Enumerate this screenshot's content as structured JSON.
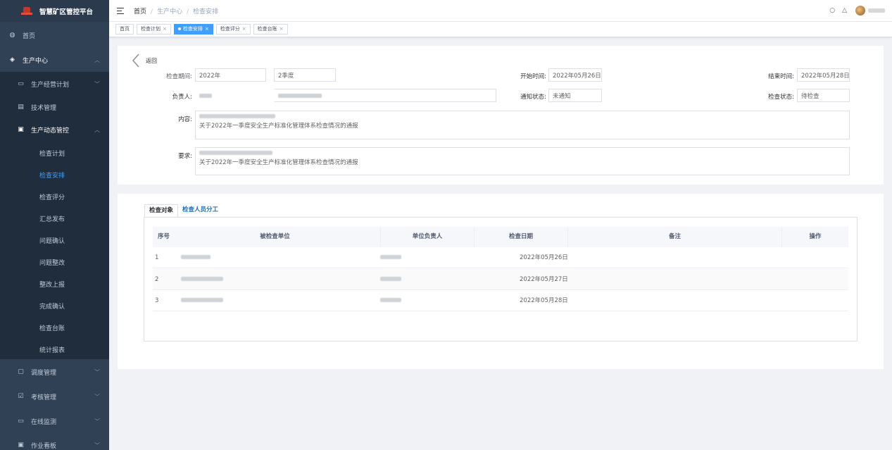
{
  "app": {
    "title": "智慧矿区管控平台"
  },
  "sidebar": {
    "home": "首页",
    "production_center": "生产中心",
    "items": [
      {
        "label": "生产经营计划",
        "icon": "book-icon"
      },
      {
        "label": "技术管理",
        "icon": "clipboard-icon"
      },
      {
        "label": "生产动态管控",
        "icon": "chart-icon"
      }
    ],
    "subitems": [
      "检查计划",
      "检查安排",
      "检查评分",
      "汇总发布",
      "问题确认",
      "问题整改",
      "整改上报",
      "完成确认",
      "检查台账",
      "统计报表"
    ],
    "active_sub": "检查安排",
    "bottom": [
      "调度管理",
      "考核管理",
      "在线监测",
      "作业看板"
    ],
    "colors": {
      "bg": "#304156",
      "active": "#409eff"
    }
  },
  "navbar": {
    "breadcrumb": [
      "首页",
      "生产中心",
      "检查安排"
    ]
  },
  "tags": [
    {
      "label": "首页",
      "closable": false,
      "active": false
    },
    {
      "label": "检查计划",
      "closable": true,
      "active": false
    },
    {
      "label": "检查安排",
      "closable": true,
      "active": true
    },
    {
      "label": "检查评分",
      "closable": true,
      "active": false
    },
    {
      "label": "检查台账",
      "closable": true,
      "active": false
    }
  ],
  "form": {
    "back_label": "返回",
    "period_label": "检查期间:",
    "year_value": "2022年",
    "quarter_value": "2季度",
    "start_label": "开始时间:",
    "start_value": "2022年05月26日",
    "end_label": "结束时间:",
    "end_value": "2022年05月28日",
    "owner_label": "负责人:",
    "notify_label": "通知状态:",
    "notify_value": "未通知",
    "check_label": "检查状态:",
    "check_value": "待检查",
    "content_label": "内容:",
    "content_value": "关于2022年一季度安全生产标准化管理体系检查情况的通报",
    "req_label": "要求:",
    "req_value": "关于2022年一季度安全生产标准化管理体系检查情况的通报"
  },
  "tabs": [
    "检查对象",
    "检查人员分工"
  ],
  "table": {
    "headers": [
      "序号",
      "被检查单位",
      "单位负责人",
      "检查日期",
      "备注",
      "操作"
    ],
    "rows": [
      {
        "no": "1",
        "date": "2022年05月26日"
      },
      {
        "no": "2",
        "date": "2022年05月27日"
      },
      {
        "no": "3",
        "date": "2022年05月28日"
      }
    ]
  }
}
